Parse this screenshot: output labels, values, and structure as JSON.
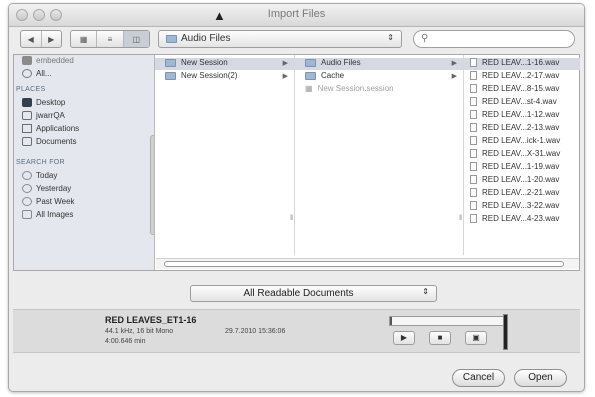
{
  "window": {
    "title": "Import Files"
  },
  "toolbar": {
    "back_icon": "◀",
    "forward_icon": "▶",
    "location": "Audio Files",
    "search_placeholder": ""
  },
  "sidebar": {
    "partial_top": "embedded",
    "all_label": "All...",
    "places_header": "PLACES",
    "places": [
      "Desktop",
      "jwarrQA",
      "Applications",
      "Documents"
    ],
    "search_header": "SEARCH FOR",
    "searches": [
      "Today",
      "Yesterday",
      "Past Week",
      "All Images"
    ]
  },
  "columns": {
    "col1": [
      "New Session",
      "New Session(2)"
    ],
    "col2": [
      "Audio Files",
      "Cache",
      "New Session.session"
    ],
    "col3": [
      "RED LEAV...1-16.wav",
      "RED LEAV...2-17.wav",
      "RED LEAV...8-15.wav",
      "RED LEAV...st-4.wav",
      "RED LEAV...1-12.wav",
      "RED LEAV...2-13.wav",
      "RED LEAV...ick-1.wav",
      "RED LEAV...X-31.wav",
      "RED LEAV...1-19.wav",
      "RED LEAV...1-20.wav",
      "RED LEAV...2-21.wav",
      "RED LEAV...3-22.wav",
      "RED LEAV...4-23.wav"
    ]
  },
  "filter": {
    "label": "All Readable Documents"
  },
  "preview": {
    "name": "RED LEAVES_ET1-16",
    "format": "44.1 kHz, 16 bit Mono",
    "duration": "4:00.646 min",
    "date": "29.7.2010 15:36:06"
  },
  "buttons": {
    "cancel": "Cancel",
    "open": "Open"
  }
}
